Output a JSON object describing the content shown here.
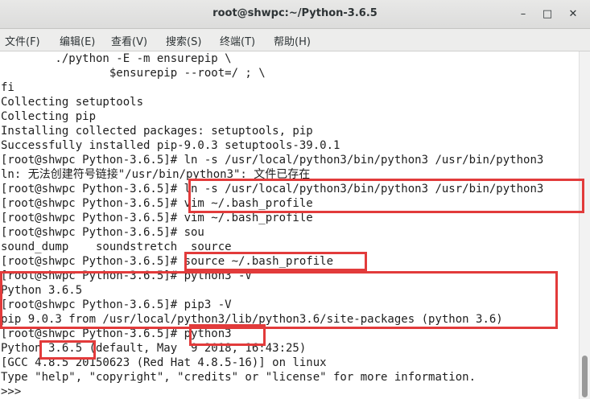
{
  "window": {
    "title": "root@shwpc:~/Python-3.6.5",
    "minimize_icon": "minimize-icon",
    "maximize_icon": "maximize-icon",
    "close_icon": "close-icon",
    "minimize_glyph": "–",
    "maximize_glyph": "□",
    "close_glyph": "✕"
  },
  "menubar": [
    {
      "label": "文件(F)"
    },
    {
      "label": "编辑(E)"
    },
    {
      "label": "查看(V)"
    },
    {
      "label": "搜索(S)"
    },
    {
      "label": "终端(T)"
    },
    {
      "label": "帮助(H)"
    }
  ],
  "terminal": {
    "lines": [
      "        ./python -E -m ensurepip \\",
      "                $ensurepip --root=/ ; \\",
      "fi",
      "Collecting setuptools",
      "Collecting pip",
      "Installing collected packages: setuptools, pip",
      "Successfully installed pip-9.0.3 setuptools-39.0.1",
      "[root@shwpc Python-3.6.5]# ln -s /usr/local/python3/bin/python3 /usr/bin/python3",
      "ln: 无法创建符号链接\"/usr/bin/python3\": 文件已存在",
      "[root@shwpc Python-3.6.5]# ln -s /usr/local/python3/bin/python3 /usr/bin/python3",
      "[root@shwpc Python-3.6.5]# vim ~/.bash_profile",
      "[root@shwpc Python-3.6.5]# vim ~/.bash_profile",
      "[root@shwpc Python-3.6.5]# sou",
      "sound_dump    soundstretch  source",
      "[root@shwpc Python-3.6.5]# source ~/.bash_profile",
      "[root@shwpc Python-3.6.5]# python3 -V",
      "Python 3.6.5",
      "[root@shwpc Python-3.6.5]# pip3 -V",
      "pip 9.0.3 from /usr/local/python3/lib/python3.6/site-packages (python 3.6)",
      "[root@shwpc Python-3.6.5]# python3",
      "Python 3.6.5 (default, May  9 2018, 16:43:25)",
      "[GCC 4.8.5 20150623 (Red Hat 4.8.5-16)] on linux",
      "Type \"help\", \"copyright\", \"credits\" or \"license\" for more information.",
      ">>> "
    ]
  },
  "colors": {
    "highlight_box": "#e23b3b",
    "terminal_bg": "#ffffff",
    "terminal_text": "#1e1e1e"
  }
}
